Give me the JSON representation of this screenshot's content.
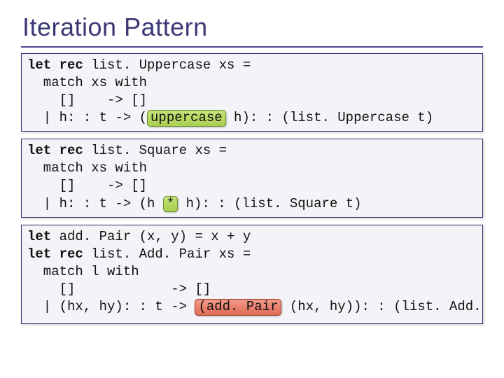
{
  "title": "Iteration Pattern",
  "box1": {
    "l1_pre": "let rec ",
    "l1_fn": "list. Uppercase",
    "l1_post": " xs =",
    "l2": "  match xs with",
    "l3": "    []    -> []",
    "l4_pre": "  | h: : t -> (",
    "l4_hl": "uppercase",
    "l4_post": " h): : (list. Uppercase t)"
  },
  "box2": {
    "l1_pre": "let rec ",
    "l1_fn": "list. Square",
    "l1_post": " xs =",
    "l2": "  match xs with",
    "l3": "    []    -> []",
    "l4_pre": "  | h: : t -> (h ",
    "l4_hl": "*",
    "l4_post": " h): : (list. Square t)"
  },
  "box3": {
    "l1_pre": "let ",
    "l1_fn": "add. Pair",
    "l1_post": " (x, y) = x + y",
    "l2_pre": "let rec ",
    "l2_fn": "list. Add. Pair",
    "l2_post": " xs =",
    "l3": "  match l with",
    "l4": "    []            -> []",
    "l5_pre": "  | (hx, hy): : t -> ",
    "l5_hl": "(add. Pair",
    "l5_post": " (hx, hy)): : (list. Add. Pair t)"
  }
}
